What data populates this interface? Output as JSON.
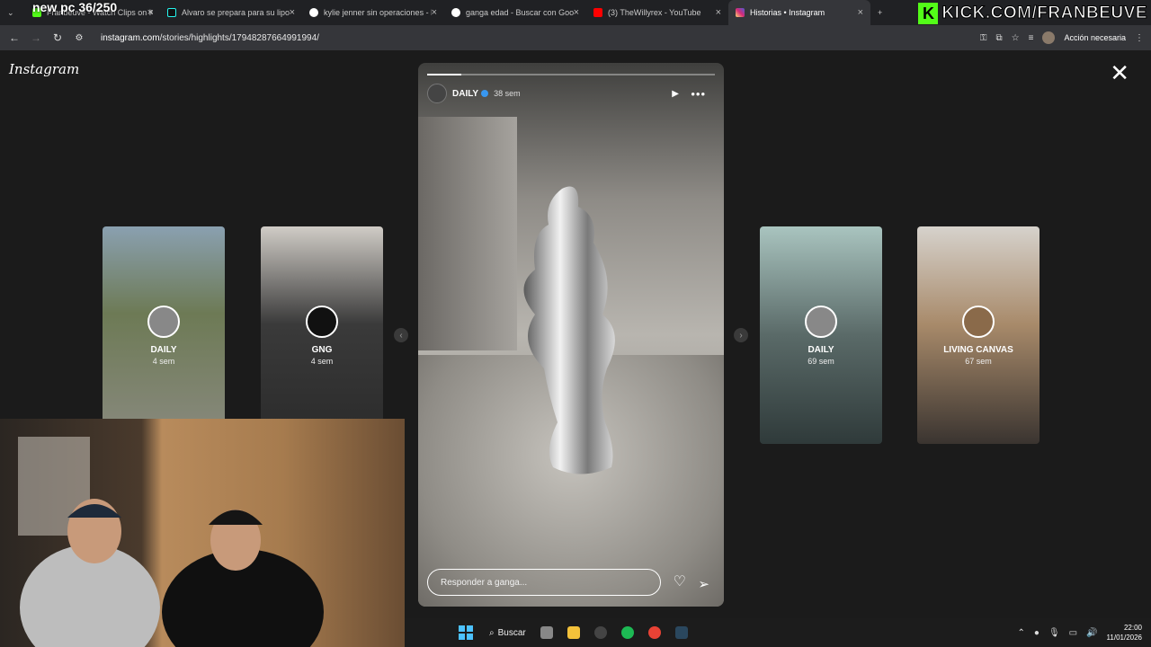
{
  "stream_overlay": {
    "counter": "new pc 36/250",
    "kick_text": "KICK.COM/FRANBEUVE",
    "kick_letter": "K"
  },
  "tabs": [
    {
      "label": "Franbeuve - Watch Clips on Kick",
      "color": "#53fc18"
    },
    {
      "label": "Alvaro se prepara para su lipos",
      "color": "#111111"
    },
    {
      "label": "kylie jenner sin operaciones - B",
      "color": "#4285f4"
    },
    {
      "label": "ganga edad - Buscar con Google",
      "color": "#4285f4"
    },
    {
      "label": "(3) TheWillyrex - YouTube",
      "color": "#ff0000"
    },
    {
      "label": "Historias • Instagram",
      "color": "#d62976"
    }
  ],
  "address_bar": {
    "url_host": "instagram.com",
    "url_path": "/stories/highlights/17948287664991994/",
    "accion": "Acción necesaria"
  },
  "instagram": {
    "logo": "Instagram",
    "story": {
      "user": "DAILY",
      "time": "38 sem",
      "reply_placeholder": "Responder a ganga...",
      "progress": 0.12
    },
    "highlights_left": [
      {
        "name": "DAILY",
        "time": "4 sem",
        "bg": "#7d8a6a"
      },
      {
        "name": "GNG",
        "time": "4 sem",
        "bg": "#4a4a4a"
      }
    ],
    "highlights_right": [
      {
        "name": "DAILY",
        "time": "69 sem",
        "bg": "#7f9a95"
      },
      {
        "name": "LIVING CANVAS",
        "time": "67 sem",
        "bg": "#8d7a6a"
      }
    ]
  },
  "taskbar": {
    "search": "Buscar",
    "time": "22:00",
    "date": "11/01/2026"
  }
}
